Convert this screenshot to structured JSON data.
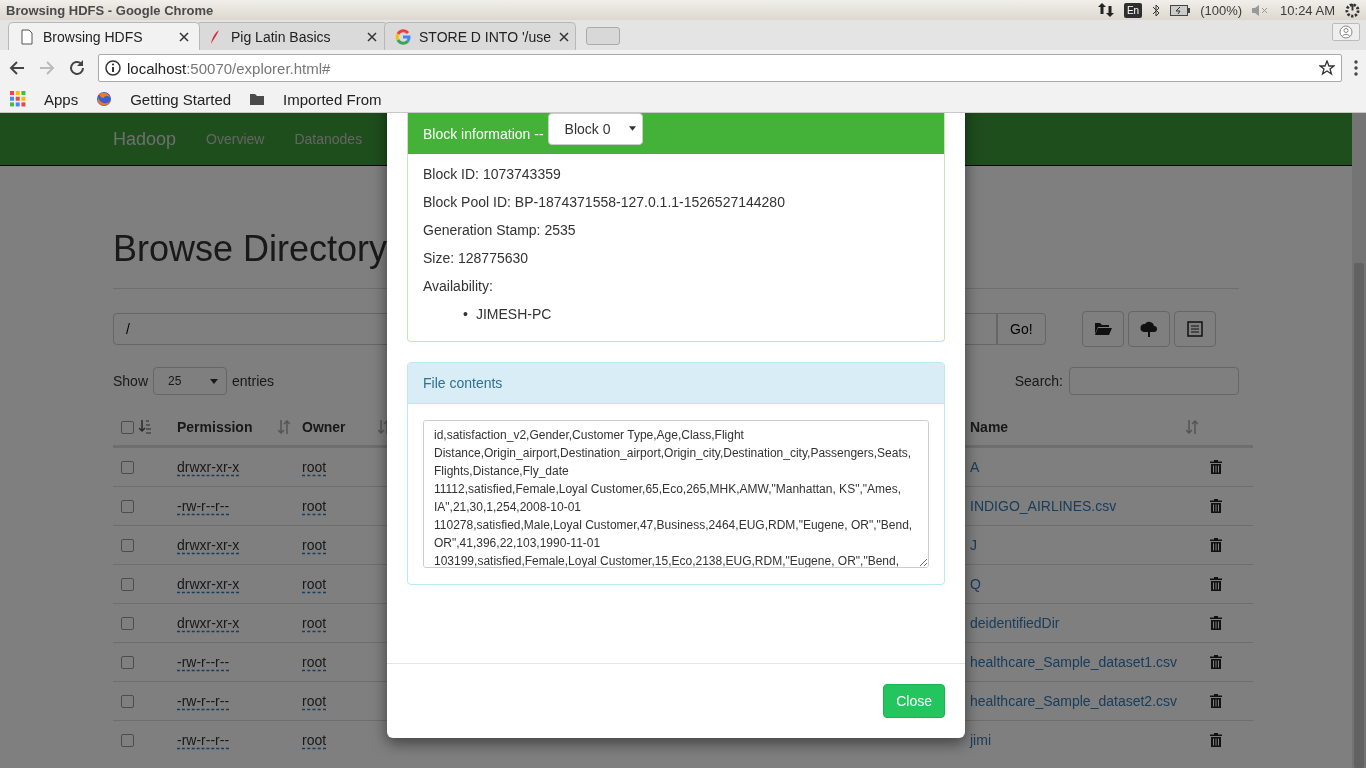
{
  "window": {
    "title": "Browsing HDFS - Google Chrome"
  },
  "tray": {
    "keyboard": "En",
    "battery": "(100%)",
    "time": "10:24 AM"
  },
  "tabs": [
    {
      "title": "Browsing HDFS",
      "selected": true
    },
    {
      "title": "Pig Latin Basics",
      "selected": false
    },
    {
      "title": "STORE D INTO '/use",
      "selected": false
    }
  ],
  "address": {
    "host": "localhost",
    "rest": ":50070/explorer.html#"
  },
  "bookmarks": [
    {
      "label": "Apps"
    },
    {
      "label": "Getting Started"
    },
    {
      "label": "Imported From"
    }
  ],
  "navbar": {
    "brand": "Hadoop",
    "items": [
      "Overview",
      "Datanodes"
    ]
  },
  "page": {
    "title": "Browse Directory",
    "path": "/",
    "go": "Go!",
    "show_label": "Show",
    "entries_value": "25",
    "entries_label": "entries",
    "search_label": "Search:"
  },
  "table": {
    "select_all": {
      "checked": false
    },
    "columns": [
      "Permission",
      "Owner",
      "Name"
    ],
    "rows": [
      {
        "checked": false,
        "permission": "drwxr-xr-x",
        "owner": "root",
        "name": "A"
      },
      {
        "checked": false,
        "permission": "-rw-r--r--",
        "owner": "root",
        "name": "INDIGO_AIRLINES.csv"
      },
      {
        "checked": false,
        "permission": "drwxr-xr-x",
        "owner": "root",
        "name": "J"
      },
      {
        "checked": false,
        "permission": "drwxr-xr-x",
        "owner": "root",
        "name": "Q"
      },
      {
        "checked": false,
        "permission": "drwxr-xr-x",
        "owner": "root",
        "name": "deidentifiedDir"
      },
      {
        "checked": false,
        "permission": "-rw-r--r--",
        "owner": "root",
        "name": "healthcare_Sample_dataset1.csv"
      },
      {
        "checked": false,
        "permission": "-rw-r--r--",
        "owner": "root",
        "name": "healthcare_Sample_dataset2.csv"
      },
      {
        "checked": false,
        "permission": "-rw-r--r--",
        "owner": "root",
        "name": "jimi"
      }
    ]
  },
  "modal": {
    "block_label": "Block information --",
    "block_select": "Block 0",
    "fields": [
      "Block ID: 1073743359",
      "Block Pool ID: BP-1874371558-127.0.1.1-1526527144280",
      "Generation Stamp: 2535",
      "Size: 128775630",
      "Availability:"
    ],
    "availability": [
      {
        "bullet": "•",
        "host": "JIMESH-PC"
      }
    ],
    "file_title": "File contents",
    "file_text": "id,satisfaction_v2,Gender,Customer Type,Age,Class,Flight Distance,Origin_airport,Destination_airport,Origin_city,Destination_city,Passengers,Seats,Flights,Distance,Fly_date\n11112,satisfied,Female,Loyal Customer,65,Eco,265,MHK,AMW,\"Manhattan, KS\",\"Ames, IA\",21,30,1,254,2008-10-01\n110278,satisfied,Male,Loyal Customer,47,Business,2464,EUG,RDM,\"Eugene, OR\",\"Bend, OR\",41,396,22,103,1990-11-01\n103199,satisfied,Female,Loyal Customer,15,Eco,2138,EUG,RDM,\"Eugene, OR\",\"Bend,",
    "close": "Close"
  }
}
